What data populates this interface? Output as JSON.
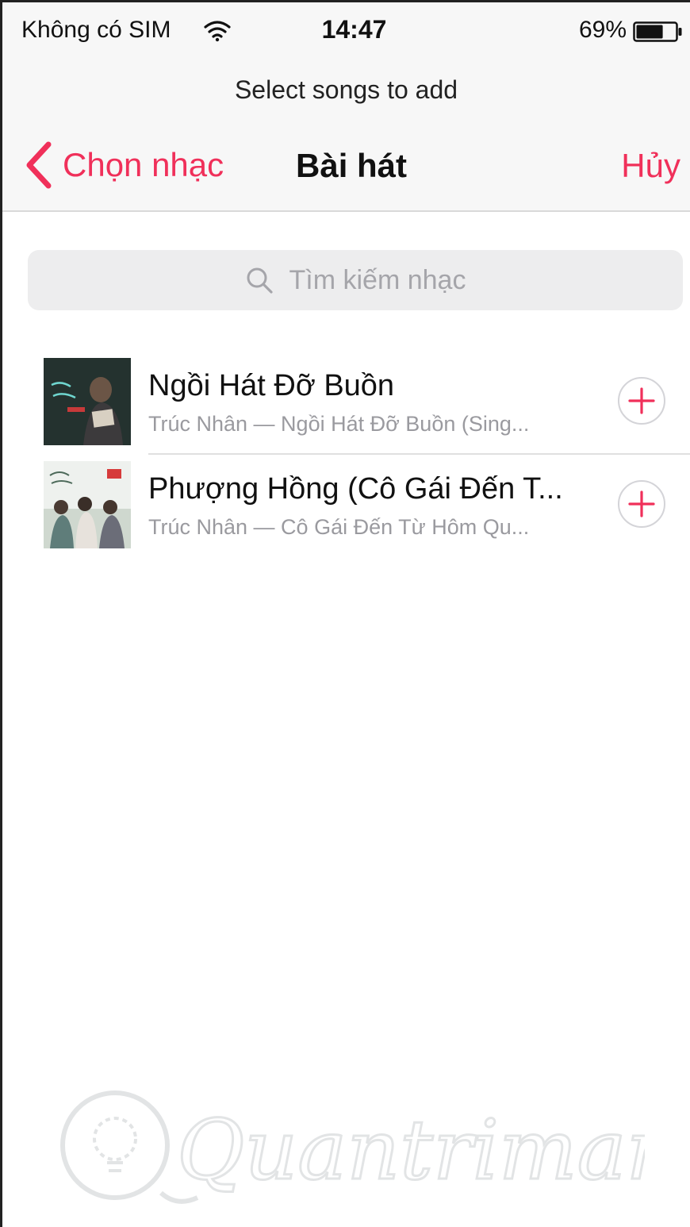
{
  "status_bar": {
    "carrier": "Không có SIM",
    "time": "14:47",
    "battery": "69%",
    "battery_level": 0.69
  },
  "prompt": "Select songs to add",
  "nav": {
    "back_label": "Chọn nhạc",
    "title": "Bài hát",
    "cancel_label": "Hủy"
  },
  "search": {
    "placeholder": "Tìm kiếm nhạc"
  },
  "songs": [
    {
      "title": "Ngồi Hát Đỡ Buồn",
      "subtitle": "Trúc Nhân — Ngồi Hát Đỡ Buồn (Sing..."
    },
    {
      "title": "Phượng Hồng (Cô Gái Đến T...",
      "subtitle": "Trúc Nhân — Cô Gái Đến Từ Hôm Qu..."
    }
  ],
  "watermark": "Quantrimang",
  "colors": {
    "accent": "#f0305a",
    "header_bg": "#f7f7f7",
    "search_bg": "#ededee",
    "secondary_text": "#9a9a9f"
  }
}
